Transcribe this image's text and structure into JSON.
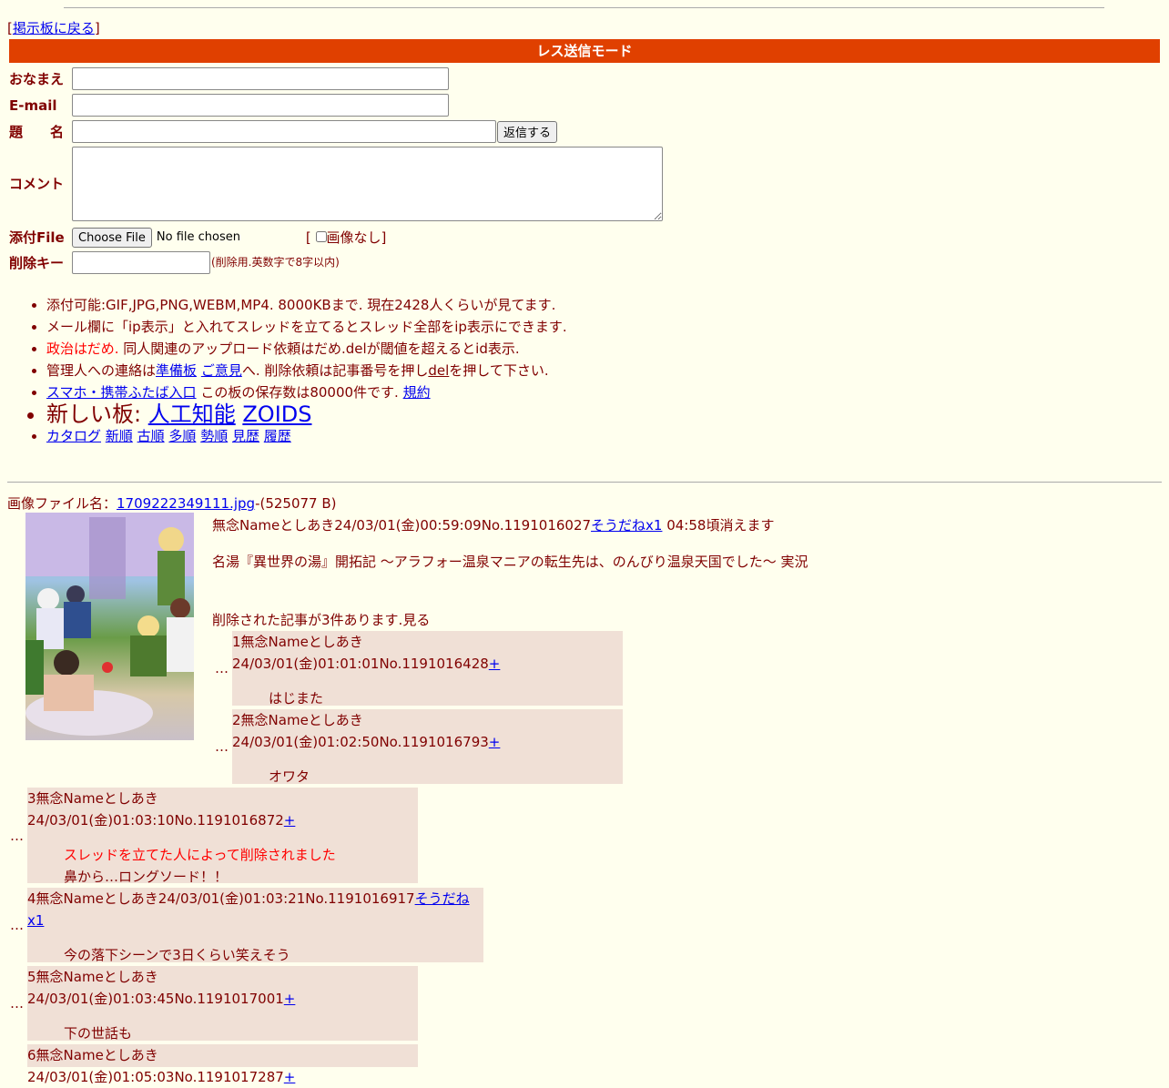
{
  "nav": {
    "back_link": "掲示板に戻る"
  },
  "mode_bar": "レス送信モード",
  "form": {
    "name_label": "おなまえ",
    "email_label": "E-mail",
    "subject_label": "題　　名",
    "submit_label": "返信する",
    "comment_label": "コメント",
    "file_label": "添付File",
    "choose_file": "Choose File",
    "no_file": "No file chosen",
    "no_image": "画像なし",
    "delkey_label": "削除キー",
    "delkey_hint": "(削除用.英数字で8字以内)"
  },
  "info": {
    "line1": "添付可能:GIF,JPG,PNG,WEBM,MP4. 8000KBまで. 現在2428人くらいが見てます.",
    "line2": "メール欄に「ip表示」と入れてスレッドを立てるとスレッド全部をip表示にできます.",
    "line3_red": "政治はだめ.",
    "line3_rest": " 同人関連のアップロード依頼はだめ.delが閾値を超えるとid表示.",
    "line4_a": "管理人への連絡は",
    "line4_link1": "準備板",
    "line4_link2": "ご意見",
    "line4_b": "へ. 削除依頼は記事番号を押し",
    "line4_del": "del",
    "line4_c": "を押して下さい.",
    "line5_link": "スマホ・携帯ふたば入口",
    "line5_text": " この板の保存数は80000件です. ",
    "line5_link2": "規約",
    "line6_text": "新しい板: ",
    "line6_link1": "人工知能",
    "line6_link2": "ZOIDS",
    "sort_links": [
      "カタログ",
      "新順",
      "古順",
      "多順",
      "勢順",
      "見歴",
      "履歴"
    ]
  },
  "op": {
    "file_label": "画像ファイル名：",
    "file_name": "1709222349111.jpg",
    "file_size": "-(525077 B)",
    "header": "無念Nameとしあき24/03/01(金)00:59:09No.1191016027",
    "soudane": "そうだねx1",
    "expire": " 04:58頃消えます",
    "title": "名湯『異世界の湯』開拓記 〜アラフォー温泉マニアの転生先は、のんびり温泉天国でした〜 実況",
    "deleted_note": "削除された記事が3件あります.見る"
  },
  "replies": [
    {
      "header": "1無念Nameとしあき24/03/01(金)01:01:01No.1191016428",
      "mark": "+",
      "body": "はじまた"
    },
    {
      "header": "2無念Nameとしあき24/03/01(金)01:02:50No.1191016793",
      "mark": "+",
      "body": "オワタ"
    },
    {
      "header": "3無念Nameとしあき24/03/01(金)01:03:10No.1191016872",
      "mark": "+",
      "deleted": "スレッドを立てた人によって削除されました",
      "body": "鼻から…ロングソード！！"
    },
    {
      "header": "4無念Nameとしあき24/03/01(金)01:03:21No.1191016917",
      "mark": "そうだねx1",
      "body": "今の落下シーンで3日くらい笑えそう"
    },
    {
      "header": "5無念Nameとしあき24/03/01(金)01:03:45No.1191017001",
      "mark": "+",
      "body": "下の世話も"
    },
    {
      "header": "6無念Nameとしあき24/03/01(金)01:05:03No.1191017287",
      "mark": "+",
      "body": ""
    }
  ],
  "ellipsis": "…"
}
